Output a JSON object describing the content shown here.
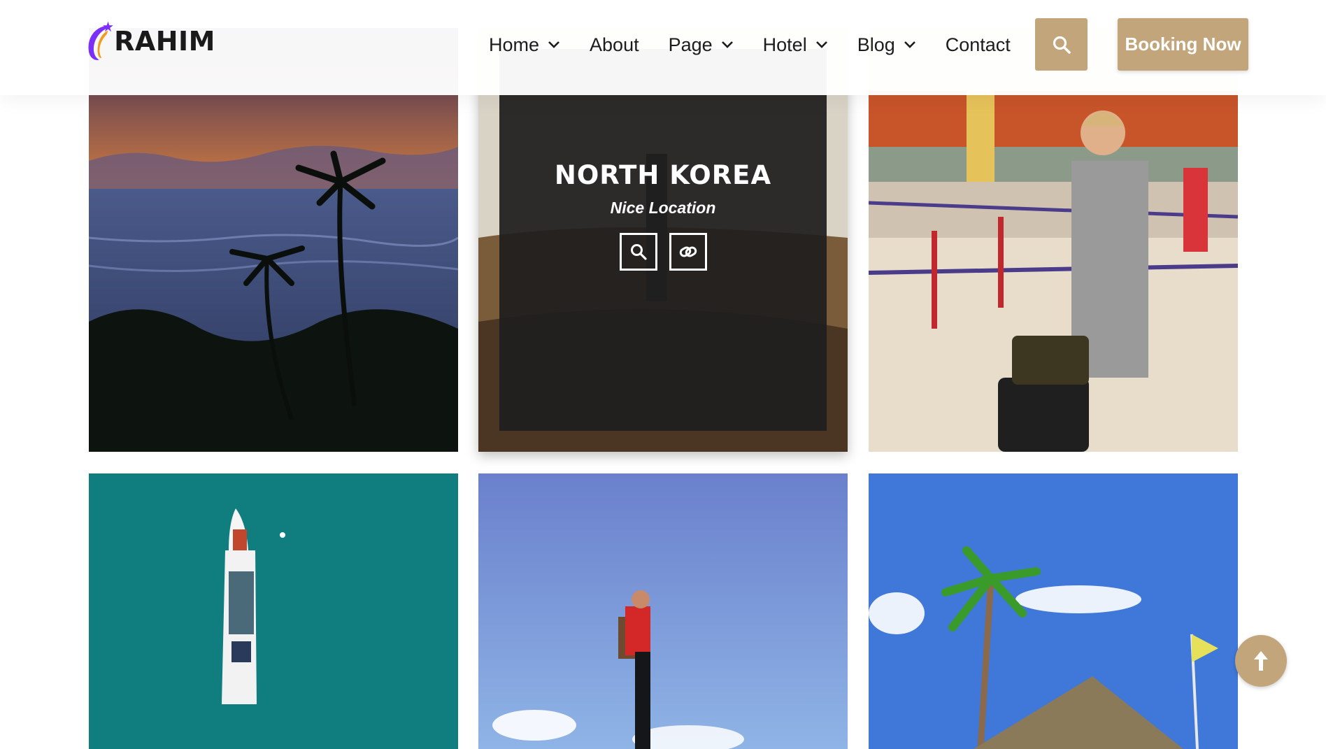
{
  "brand": {
    "name": "RAHIM",
    "accent": "#c3a57b",
    "logo_colors": [
      "#7b2ff7",
      "#f29b1d"
    ]
  },
  "nav": {
    "items": [
      {
        "label": "Home",
        "dropdown": true
      },
      {
        "label": "About",
        "dropdown": false
      },
      {
        "label": "Page",
        "dropdown": true
      },
      {
        "label": "Hotel",
        "dropdown": true
      },
      {
        "label": "Blog",
        "dropdown": true
      },
      {
        "label": "Contact",
        "dropdown": false
      }
    ],
    "search_icon": "search-icon",
    "booking_label": "Booking Now"
  },
  "gallery": {
    "items": [
      {
        "scene": "tropical sunset beach with palm trees"
      },
      {
        "scene": "hiker on hill",
        "overlay": {
          "title": "NORTH KOREA",
          "subtitle": "Nice Location",
          "icons": [
            "search-icon",
            "link-icon"
          ]
        }
      },
      {
        "scene": "woman with luggage at airport"
      },
      {
        "scene": "aerial boat on turquoise sea"
      },
      {
        "scene": "traveler in red jacket against blue sky"
      },
      {
        "scene": "palm trees and thatched hut"
      }
    ]
  },
  "scroll_top_icon": "arrow-up-icon"
}
